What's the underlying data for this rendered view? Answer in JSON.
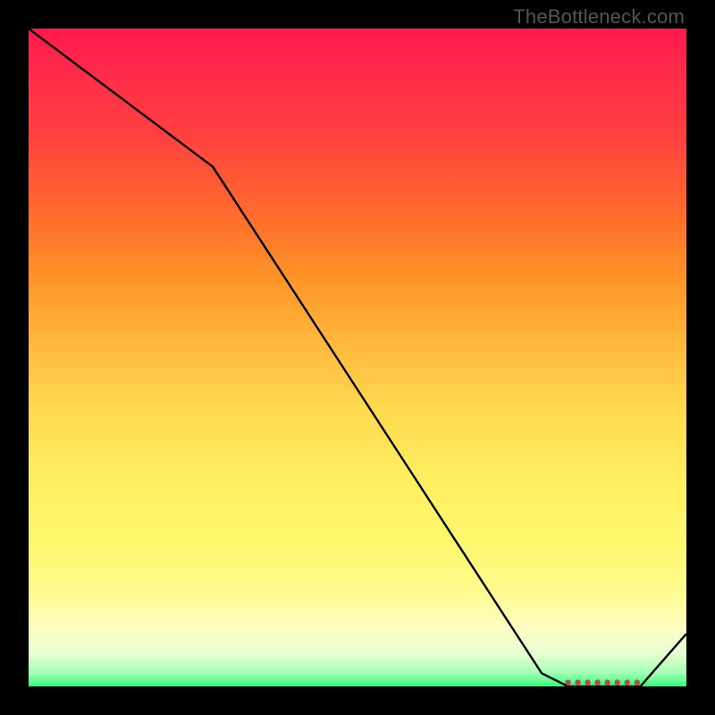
{
  "watermark": "TheBottleneck.com",
  "chart_data": {
    "type": "line",
    "title": "",
    "xlabel": "",
    "ylabel": "",
    "xlim": [
      0,
      100
    ],
    "ylim": [
      0,
      100
    ],
    "series": [
      {
        "name": "curve",
        "x": [
          0,
          28,
          78,
          82,
          93,
          100
        ],
        "values": [
          100,
          79,
          2,
          0,
          0,
          8
        ]
      }
    ],
    "markers": {
      "name": "flat-region-markers",
      "x": [
        82,
        83.5,
        85,
        86.5,
        88,
        89.5,
        91,
        92.5
      ],
      "values": [
        0.6,
        0.6,
        0.6,
        0.6,
        0.6,
        0.6,
        0.6,
        0.6
      ],
      "color": "#c8424a",
      "radius_px": 3.2
    }
  }
}
